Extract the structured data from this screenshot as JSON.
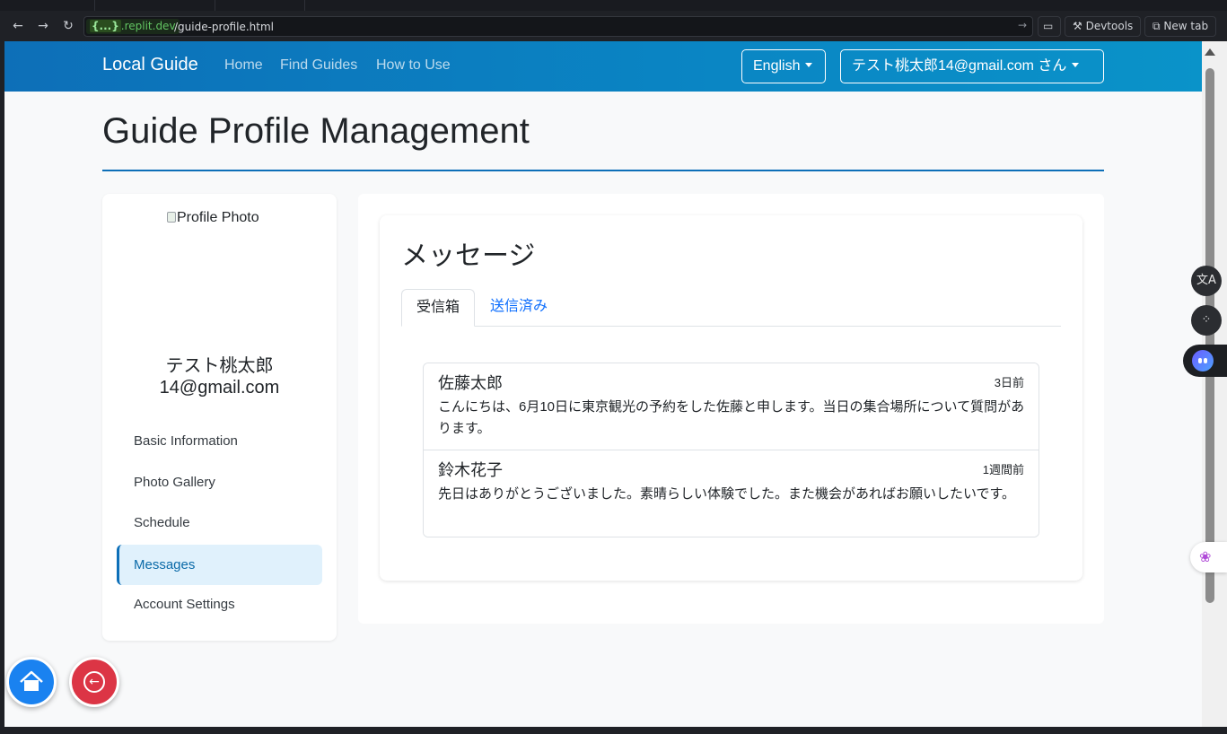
{
  "browser": {
    "host_prefix": "{...}",
    "host": ".replit.dev",
    "path": "/guide-profile.html",
    "devtools_label": "Devtools",
    "new_tab_label": "New tab"
  },
  "navbar": {
    "brand": "Local Guide",
    "links": [
      "Home",
      "Find Guides",
      "How to Use"
    ],
    "language": "English",
    "user": "テスト桃太郎14@gmail.com さん"
  },
  "page": {
    "title": "Guide Profile Management"
  },
  "sidebar": {
    "photo_alt": "Profile Photo",
    "name_line1": "テスト桃太郎",
    "name_line2": "14@gmail.com",
    "items": [
      {
        "label": "Basic Information"
      },
      {
        "label": "Photo Gallery"
      },
      {
        "label": "Schedule"
      },
      {
        "label": "Messages"
      },
      {
        "label": "Account Settings"
      }
    ],
    "active_item": "Messages"
  },
  "messages": {
    "title": "メッセージ",
    "tabs": [
      {
        "label": "受信箱"
      },
      {
        "label": "送信済み"
      }
    ],
    "active_tab": "受信箱",
    "items": [
      {
        "sender": "佐藤太郎",
        "time": "3日前",
        "body": "こんにちは、6月10日に東京観光の予約をした佐藤と申します。当日の集合場所について質問があります。"
      },
      {
        "sender": "鈴木花子",
        "time": "1週間前",
        "body": "先日はありがとうございました。素晴らしい体験でした。また機会があればお願いしたいです。"
      }
    ]
  },
  "colors": {
    "navbar_start": "#0d6fb8",
    "navbar_end": "#0a93c9",
    "accent": "#0d6fb8",
    "active_bg": "#e0f1fc",
    "link": "#0d6efd",
    "home_fab": "#1a82f0",
    "back_fab": "#dc3545"
  },
  "icons": {
    "home": "home-icon",
    "back": "arrow-left-icon",
    "translate": "translate-icon",
    "apps": "apps-icon",
    "assistant": "assistant-icon",
    "brain": "brain-icon"
  }
}
